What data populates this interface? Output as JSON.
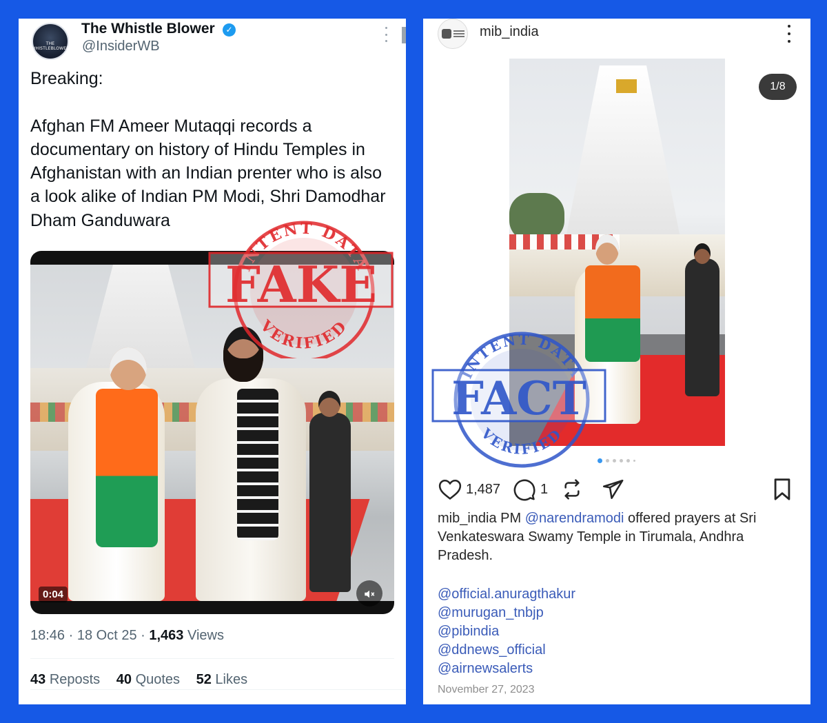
{
  "tweet": {
    "display_name": "The Whistle Blower",
    "handle": "@InsiderWB",
    "avatar_text_top": "THE",
    "avatar_text_bottom": "WHISTLEBLOWER",
    "verified_icon": "check-badge-icon",
    "text": "Breaking:\n\nAfghan FM Ameer Mutaqqi records a documentary on history of Hindu Temples in Afghanistan with an Indian prenter who is also a look alike of Indian PM Modi, Shri Damodhar Dham Ganduwara",
    "video": {
      "timestamp": "0:04",
      "mute_icon": "speaker-muted-icon"
    },
    "meta": {
      "time": "18:46",
      "date": "18 Oct 25",
      "views_count": "1,463",
      "views_label": "Views"
    },
    "stats": [
      {
        "count": "43",
        "label": "Reposts"
      },
      {
        "count": "40",
        "label": "Quotes"
      },
      {
        "count": "52",
        "label": "Likes"
      }
    ]
  },
  "instagram": {
    "username": "mib_india",
    "image_counter": "1/8",
    "likes": "1,487",
    "comments": "1",
    "caption_user": "mib_india",
    "caption_prefix": "PM",
    "caption_mention": "@narendramodi",
    "caption_text": "offered prayers at Sri Venkateswara Swamy Temple in Tirumala, Andhra Pradesh.",
    "tags": [
      "@official.anuragthakur",
      "@murugan_tnbjp",
      "@pibindia",
      "@ddnews_official",
      "@airnewsalerts"
    ],
    "date": "November 27, 2023"
  },
  "stamps": {
    "fake": {
      "top_text": "INTENT DATA",
      "main_text": "FAKE",
      "bottom_text": "VERIFIED",
      "color": "#e0282b"
    },
    "fact": {
      "top_text": "INTENT DATA",
      "main_text": "FACT",
      "bottom_text": "VERIFIED",
      "color": "#2f56c9"
    }
  },
  "colors": {
    "background": "#1659e6",
    "twitter_blue": "#1d9bf0",
    "instagram_link": "#3a5bb8"
  }
}
